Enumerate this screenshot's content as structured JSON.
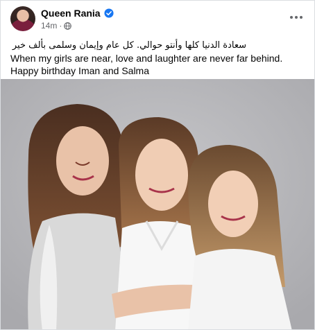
{
  "post": {
    "author": "Queen Rania",
    "time": "14m",
    "separator": "·",
    "text_arabic": "سعادة الدنيا كلها وأنتو حوالي. كل عام وإيمان وسلمى بألف خير",
    "text_english": "When my girls are near, love and laughter are never far behind. Happy birthday Iman and Salma"
  },
  "icons": {
    "verified": "verified-badge-icon",
    "privacy": "globe-icon",
    "more": "more-options-icon"
  },
  "colors": {
    "verified_blue": "#1877f2",
    "secondary_text": "#65676b",
    "primary_text": "#050505"
  }
}
